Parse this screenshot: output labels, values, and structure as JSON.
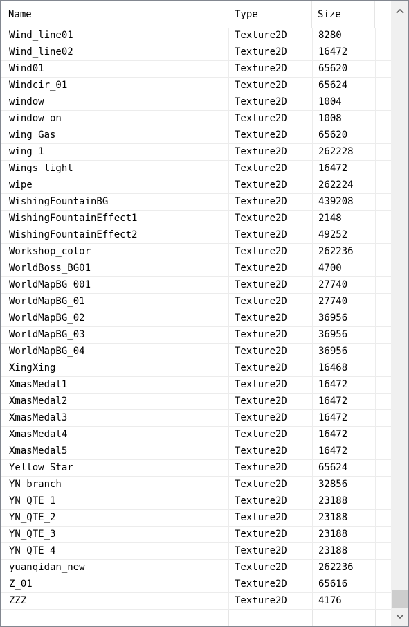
{
  "columns": {
    "name": "Name",
    "type": "Type",
    "size": "Size"
  },
  "rows": [
    {
      "name": "Wind_line01",
      "type": "Texture2D",
      "size": "8280"
    },
    {
      "name": "Wind_line02",
      "type": "Texture2D",
      "size": "16472"
    },
    {
      "name": "Wind01",
      "type": "Texture2D",
      "size": "65620"
    },
    {
      "name": "Windcir_01",
      "type": "Texture2D",
      "size": "65624"
    },
    {
      "name": "window",
      "type": "Texture2D",
      "size": "1004"
    },
    {
      "name": "window on",
      "type": "Texture2D",
      "size": "1008"
    },
    {
      "name": "wing Gas",
      "type": "Texture2D",
      "size": "65620"
    },
    {
      "name": "wing_1",
      "type": "Texture2D",
      "size": "262228"
    },
    {
      "name": "Wings light",
      "type": "Texture2D",
      "size": "16472"
    },
    {
      "name": "wipe",
      "type": "Texture2D",
      "size": "262224"
    },
    {
      "name": "WishingFountainBG",
      "type": "Texture2D",
      "size": "439208"
    },
    {
      "name": "WishingFountainEffect1",
      "type": "Texture2D",
      "size": "2148"
    },
    {
      "name": "WishingFountainEffect2",
      "type": "Texture2D",
      "size": "49252"
    },
    {
      "name": "Workshop_color",
      "type": "Texture2D",
      "size": "262236"
    },
    {
      "name": "WorldBoss_BG01",
      "type": "Texture2D",
      "size": "4700"
    },
    {
      "name": "WorldMapBG_001",
      "type": "Texture2D",
      "size": "27740"
    },
    {
      "name": "WorldMapBG_01",
      "type": "Texture2D",
      "size": "27740"
    },
    {
      "name": "WorldMapBG_02",
      "type": "Texture2D",
      "size": "36956"
    },
    {
      "name": "WorldMapBG_03",
      "type": "Texture2D",
      "size": "36956"
    },
    {
      "name": "WorldMapBG_04",
      "type": "Texture2D",
      "size": "36956"
    },
    {
      "name": "XingXing",
      "type": "Texture2D",
      "size": "16468"
    },
    {
      "name": "XmasMedal1",
      "type": "Texture2D",
      "size": "16472"
    },
    {
      "name": "XmasMedal2",
      "type": "Texture2D",
      "size": "16472"
    },
    {
      "name": "XmasMedal3",
      "type": "Texture2D",
      "size": "16472"
    },
    {
      "name": "XmasMedal4",
      "type": "Texture2D",
      "size": "16472"
    },
    {
      "name": "XmasMedal5",
      "type": "Texture2D",
      "size": "16472"
    },
    {
      "name": "Yellow Star",
      "type": "Texture2D",
      "size": "65624"
    },
    {
      "name": "YN branch",
      "type": "Texture2D",
      "size": "32856"
    },
    {
      "name": "YN_QTE_1",
      "type": "Texture2D",
      "size": "23188"
    },
    {
      "name": "YN_QTE_2",
      "type": "Texture2D",
      "size": "23188"
    },
    {
      "name": "YN_QTE_3",
      "type": "Texture2D",
      "size": "23188"
    },
    {
      "name": "YN_QTE_4",
      "type": "Texture2D",
      "size": "23188"
    },
    {
      "name": "yuanqidan_new",
      "type": "Texture2D",
      "size": "262236"
    },
    {
      "name": "Z_01",
      "type": "Texture2D",
      "size": "65616"
    },
    {
      "name": "ZZZ",
      "type": "Texture2D",
      "size": "4176"
    }
  ],
  "scrollbar": {
    "position": 1.0,
    "up_icon": "chevron-up-icon",
    "down_icon": "chevron-down-icon"
  },
  "colors": {
    "border": "#828790",
    "grid": "#ececec",
    "scrollbar_track": "#f0f0f0",
    "scrollbar_thumb": "#cdcdcd"
  }
}
